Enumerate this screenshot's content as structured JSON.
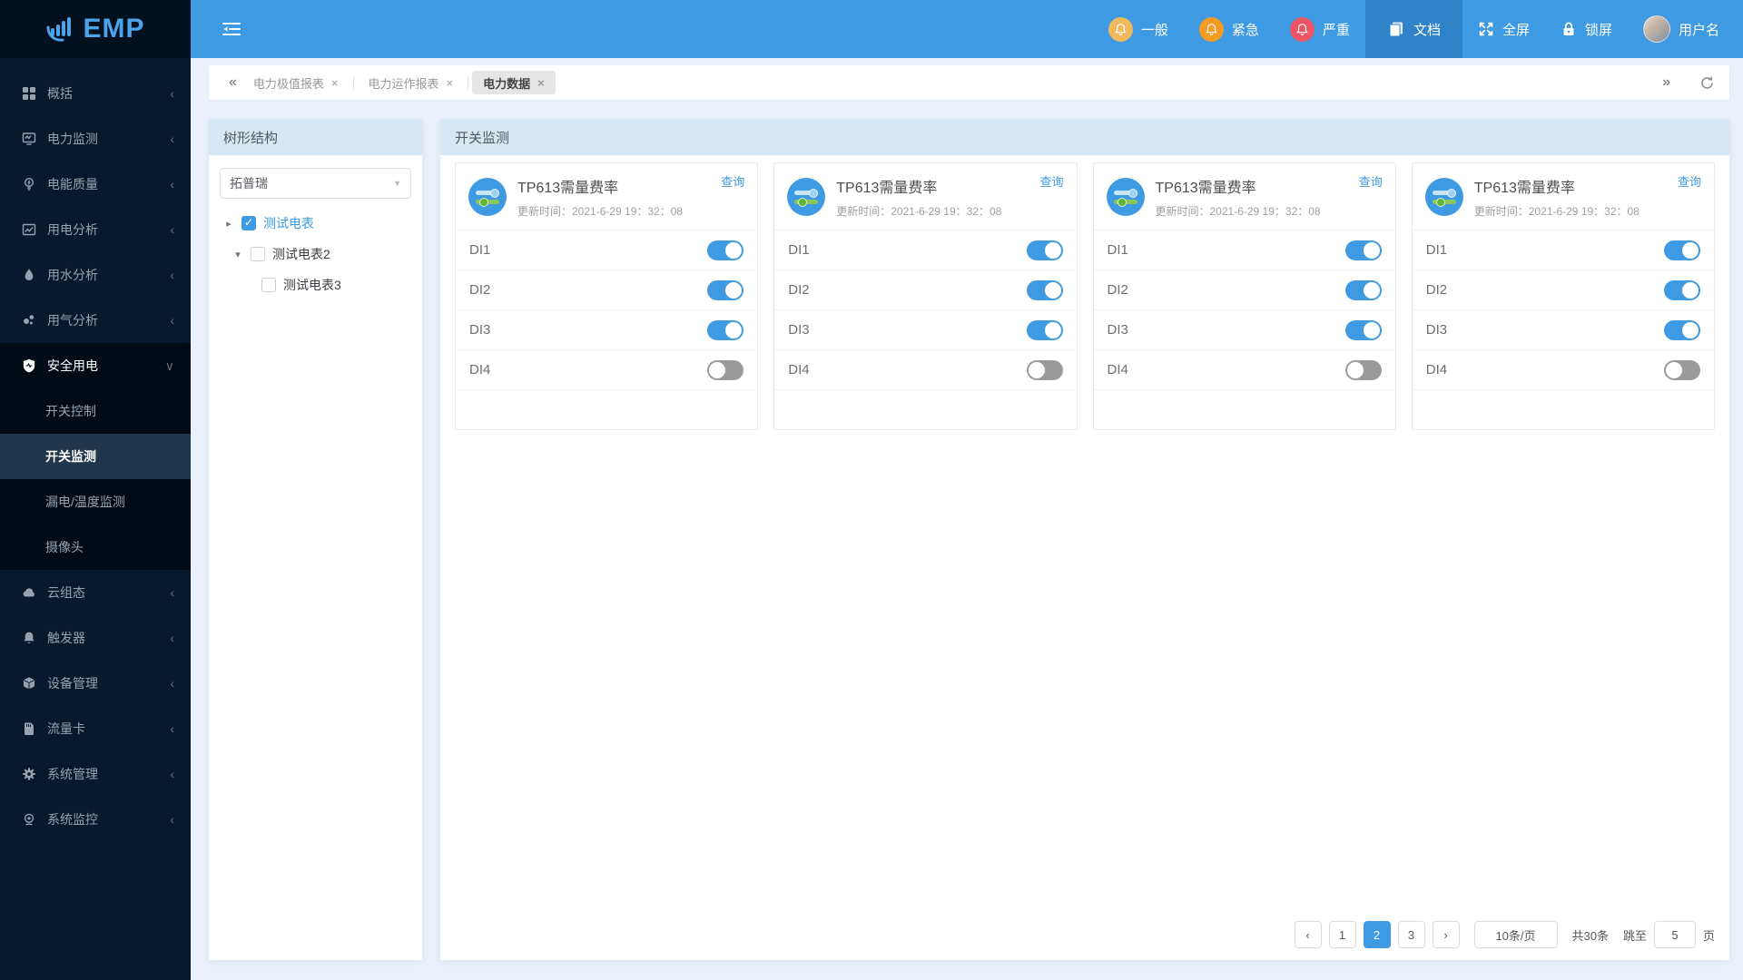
{
  "colors": {
    "accent": "#3D9AE3",
    "navbar": "#3D9AE3",
    "navbar_active": "#2F83C8",
    "sidebar_bg": "#07192E",
    "submenu_bg": "#000B15",
    "selected_item_bg": "#20364D",
    "panel_head_bg": "#D7E8F5",
    "toggle_on": "#3D9AE3",
    "toggle_off": "#9A9A9A",
    "notif_general": "#EFB95D",
    "notif_urgent": "#F59A23",
    "notif_severe": "#ED5565"
  },
  "sidebar": {
    "logo_text": "EMP",
    "items": [
      {
        "label": "概括",
        "icon": "grid-icon",
        "chevron": "‹"
      },
      {
        "label": "电力监测",
        "icon": "monitor-icon",
        "chevron": "‹"
      },
      {
        "label": "电能质量",
        "icon": "bulb-icon",
        "chevron": "‹"
      },
      {
        "label": "用电分析",
        "icon": "chart-icon",
        "chevron": "‹"
      },
      {
        "label": "用水分析",
        "icon": "water-drop-icon",
        "chevron": "‹"
      },
      {
        "label": "用气分析",
        "icon": "gas-bubbles-icon",
        "chevron": "‹"
      },
      {
        "label": "安全用电",
        "icon": "shield-icon",
        "chevron": "∨",
        "state": "expanded"
      },
      {
        "label": "云组态",
        "icon": "cloud-icon",
        "chevron": "‹"
      },
      {
        "label": "触发器",
        "icon": "bell-icon",
        "chevron": "‹"
      },
      {
        "label": "设备管理",
        "icon": "cube-icon",
        "chevron": "‹"
      },
      {
        "label": "流量卡",
        "icon": "sim-card-icon",
        "chevron": "‹"
      },
      {
        "label": "系统管理",
        "icon": "gear-icon",
        "chevron": "‹"
      },
      {
        "label": "系统监控",
        "icon": "webcam-icon",
        "chevron": "‹"
      }
    ],
    "submenu": [
      {
        "label": "开关控制",
        "state": "normal"
      },
      {
        "label": "开关监测",
        "state": "selected"
      },
      {
        "label": "漏电/温度监测",
        "state": "normal"
      },
      {
        "label": "摄像头",
        "state": "normal"
      }
    ]
  },
  "navbar": {
    "notifications": [
      {
        "label": "一般",
        "icon": "bell-icon"
      },
      {
        "label": "紧急",
        "icon": "bell-icon"
      },
      {
        "label": "严重",
        "icon": "bell-icon"
      }
    ],
    "doc_label": "文档",
    "fullscreen_label": "全屏",
    "lock_label": "锁屏",
    "username": "用户名"
  },
  "tabbar": {
    "scroll_left": "«",
    "scroll_right": "»",
    "close_glyph": "×",
    "tabs": [
      {
        "label": "电力极值报表",
        "state": "normal"
      },
      {
        "label": "电力运作报表",
        "state": "normal"
      },
      {
        "label": "电力数据",
        "state": "active"
      }
    ]
  },
  "tree": {
    "title": "树形结构",
    "select_value": "拓普瑞",
    "select_caret": "▼",
    "nodes": [
      {
        "label": "测试电表",
        "caret": "▸",
        "state": "checked",
        "indent": 0
      },
      {
        "label": "测试电表2",
        "caret": "▾",
        "state": "unchecked",
        "indent": 1
      },
      {
        "label": "测试电表3",
        "caret": "",
        "state": "unchecked",
        "indent": 2
      }
    ]
  },
  "main": {
    "title": "开关监测",
    "cards": [
      {
        "query_label": "查询",
        "title": "TP613需量费率",
        "updated": "更新时间：2021-6-29 19：32：08",
        "rows": [
          {
            "label": "DI1",
            "state": "on"
          },
          {
            "label": "DI2",
            "state": "on"
          },
          {
            "label": "DI3",
            "state": "on"
          },
          {
            "label": "DI4",
            "state": "off"
          }
        ]
      },
      {
        "query_label": "查询",
        "title": "TP613需量费率",
        "updated": "更新时间：2021-6-29 19：32：08",
        "rows": [
          {
            "label": "DI1",
            "state": "on"
          },
          {
            "label": "DI2",
            "state": "on"
          },
          {
            "label": "DI3",
            "state": "on"
          },
          {
            "label": "DI4",
            "state": "off"
          }
        ]
      },
      {
        "query_label": "查询",
        "title": "TP613需量费率",
        "updated": "更新时间：2021-6-29 19：32：08",
        "rows": [
          {
            "label": "DI1",
            "state": "on"
          },
          {
            "label": "DI2",
            "state": "on"
          },
          {
            "label": "DI3",
            "state": "on"
          },
          {
            "label": "DI4",
            "state": "off"
          }
        ]
      },
      {
        "query_label": "查询",
        "title": "TP613需量费率",
        "updated": "更新时间：2021-6-29 19：32：08",
        "rows": [
          {
            "label": "DI1",
            "state": "on"
          },
          {
            "label": "DI2",
            "state": "on"
          },
          {
            "label": "DI3",
            "state": "on"
          },
          {
            "label": "DI4",
            "state": "off"
          }
        ]
      }
    ]
  },
  "pagination": {
    "prev": "‹",
    "next": "›",
    "pages": [
      {
        "label": "1",
        "state": "normal"
      },
      {
        "label": "2",
        "state": "active"
      },
      {
        "label": "3",
        "state": "normal"
      }
    ],
    "page_size": "10条/页",
    "total": "共30条",
    "jump_label": "跳至",
    "jump_value": "5",
    "page_unit": "页"
  }
}
